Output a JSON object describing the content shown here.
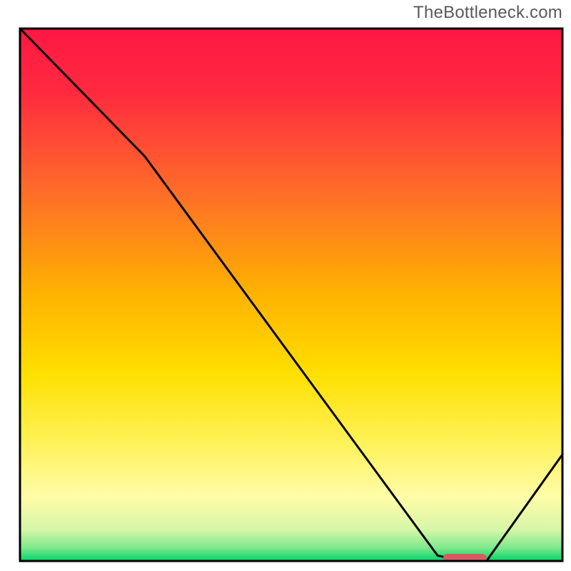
{
  "watermark": "TheBottleneck.com",
  "chart_data": {
    "type": "line",
    "title": "",
    "xlabel": "",
    "ylabel": "",
    "xlim": [
      0,
      100
    ],
    "ylim": [
      0,
      100
    ],
    "x": [
      0,
      23,
      77,
      82,
      86,
      100
    ],
    "values": [
      100,
      76,
      1,
      0,
      0,
      20
    ],
    "marker": {
      "x_start": 78,
      "x_end": 86,
      "y": 0
    },
    "background_gradient": {
      "stops": [
        {
          "offset": 0.0,
          "color": "#ff1744"
        },
        {
          "offset": 0.12,
          "color": "#ff2a3f"
        },
        {
          "offset": 0.3,
          "color": "#ff6a2a"
        },
        {
          "offset": 0.5,
          "color": "#ffb300"
        },
        {
          "offset": 0.65,
          "color": "#ffe000"
        },
        {
          "offset": 0.78,
          "color": "#fff25a"
        },
        {
          "offset": 0.88,
          "color": "#fffca8"
        },
        {
          "offset": 0.94,
          "color": "#d7f7a8"
        },
        {
          "offset": 0.975,
          "color": "#7fe88c"
        },
        {
          "offset": 1.0,
          "color": "#00d66b"
        }
      ]
    },
    "colors": {
      "line": "#000000",
      "marker_fill": "#d85a63",
      "frame": "#000000",
      "outer_bg": "#ffffff"
    }
  }
}
